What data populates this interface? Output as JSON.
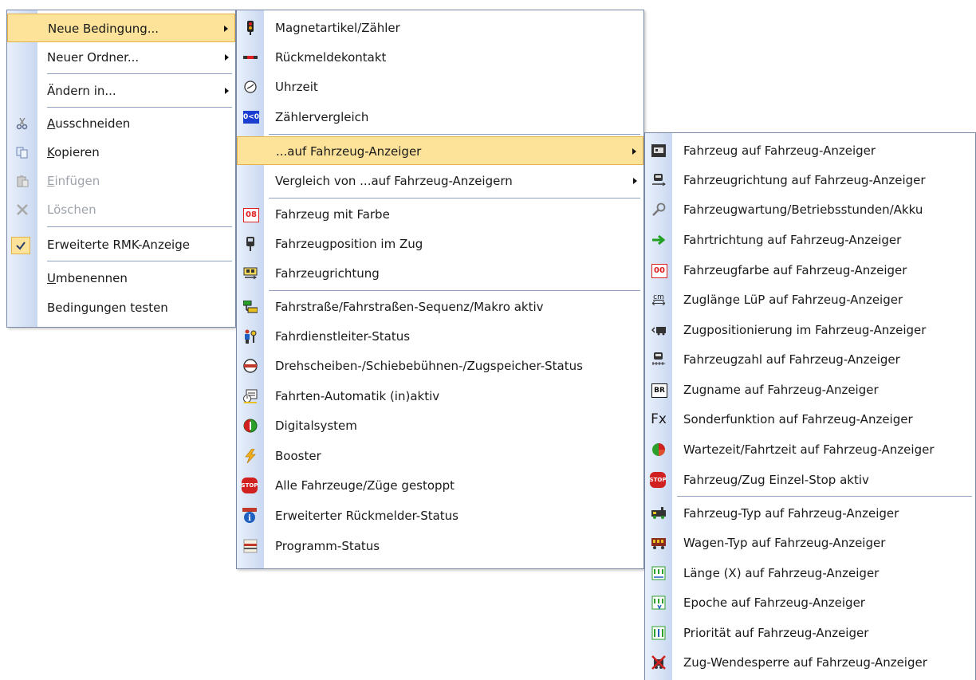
{
  "menu_main": {
    "items": [
      {
        "label": "Neue Bedingung...",
        "icon": "",
        "submenu": true,
        "highlighted": true
      },
      {
        "label": "Neuer Ordner...",
        "icon": "",
        "submenu": true
      },
      {
        "label": "Ändern in...",
        "icon": "",
        "submenu": true
      },
      {
        "label": "Ausschneiden",
        "icon": "scissors-icon",
        "accelerator_pre": "",
        "accelerator": "A",
        "accelerator_post": "usschneiden"
      },
      {
        "label": "Kopieren",
        "icon": "copy-icon",
        "accelerator_pre": "",
        "accelerator": "K",
        "accelerator_post": "opieren"
      },
      {
        "label": "Einfügen",
        "icon": "paste-icon",
        "disabled": true,
        "accelerator_pre": "",
        "accelerator": "E",
        "accelerator_post": "infügen"
      },
      {
        "label": "Löschen",
        "icon": "delete-icon",
        "disabled": true
      },
      {
        "label": "Erweiterte RMK-Anzeige",
        "icon": "checkmark-icon",
        "checked": true
      },
      {
        "label": "Umbenennen",
        "icon": "",
        "accelerator_pre": "",
        "accelerator": "U",
        "accelerator_post": "mbenennen"
      },
      {
        "label": "Bedingungen testen",
        "icon": ""
      }
    ]
  },
  "menu_conditions": {
    "items": [
      {
        "label": "Magnetartikel/Zähler",
        "icon": "signal-icon"
      },
      {
        "label": "Rückmeldekontakt",
        "icon": "feedback-contact-icon"
      },
      {
        "label": "Uhrzeit",
        "icon": "clock-icon"
      },
      {
        "label": "Zählervergleich",
        "icon": "counter-compare-icon",
        "icon_text": "0<0"
      },
      {
        "label": "...auf Fahrzeug-Anzeiger",
        "icon": "",
        "submenu": true,
        "highlighted": true
      },
      {
        "label": "Vergleich von ...auf Fahrzeug-Anzeigern",
        "icon": "",
        "submenu": true
      },
      {
        "label": "Fahrzeug mit Farbe",
        "icon": "vehicle-color-icon",
        "icon_text": "08"
      },
      {
        "label": "Fahrzeugposition im Zug",
        "icon": "vehicle-position-icon"
      },
      {
        "label": "Fahrzeugrichtung",
        "icon": "vehicle-direction-icon"
      },
      {
        "label": "Fahrstraße/Fahrstraßen-Sequenz/Makro aktiv",
        "icon": "route-icon"
      },
      {
        "label": "Fahrdienstleiter-Status",
        "icon": "dispatcher-icon"
      },
      {
        "label": "Drehscheiben-/Schiebebühnen-/Zugspeicher-Status",
        "icon": "turntable-icon"
      },
      {
        "label": "Fahrten-Automatik (in)aktiv",
        "icon": "automatic-icon"
      },
      {
        "label": "Digitalsystem",
        "icon": "digital-system-icon"
      },
      {
        "label": "Booster",
        "icon": "lightning-icon"
      },
      {
        "label": "Alle Fahrzeuge/Züge gestoppt",
        "icon": "stop-icon",
        "icon_text": "STOP"
      },
      {
        "label": "Erweiterter Rückmelder-Status",
        "icon": "info-icon",
        "icon_text": "i"
      },
      {
        "label": "Programm-Status",
        "icon": "program-icon"
      }
    ]
  },
  "menu_vehicle_display": {
    "items": [
      {
        "label": "Fahrzeug auf Fahrzeug-Anzeiger",
        "icon": "vehicle-display-icon"
      },
      {
        "label": "Fahrzeugrichtung auf Fahrzeug-Anzeiger",
        "icon": "vehicle-direction-display-icon"
      },
      {
        "label": "Fahrzeugwartung/Betriebsstunden/Akku",
        "icon": "wrench-icon"
      },
      {
        "label": "Fahrtrichtung auf Fahrzeug-Anzeiger",
        "icon": "green-arrow-icon"
      },
      {
        "label": "Fahrzeugfarbe auf Fahrzeug-Anzeiger",
        "icon": "vehicle-color-icon",
        "icon_text": "00"
      },
      {
        "label": "Zuglänge LüP auf Fahrzeug-Anzeiger",
        "icon": "length-cm-icon",
        "icon_text": "cm"
      },
      {
        "label": "Zugpositionierung im Fahrzeug-Anzeiger",
        "icon": "train-position-icon"
      },
      {
        "label": "Fahrzeugzahl auf Fahrzeug-Anzeiger",
        "icon": "vehicle-count-icon"
      },
      {
        "label": "Zugname auf Fahrzeug-Anzeiger",
        "icon": "train-name-icon",
        "icon_text": "BR"
      },
      {
        "label": "Sonderfunktion auf Fahrzeug-Anzeiger",
        "icon": "function-icon",
        "icon_text": "Fx"
      },
      {
        "label": "Wartezeit/Fahrtzeit auf Fahrzeug-Anzeiger",
        "icon": "pie-timer-icon"
      },
      {
        "label": "Fahrzeug/Zug Einzel-Stop aktiv",
        "icon": "stop-icon",
        "icon_text": "STOP"
      },
      {
        "label": "Fahrzeug-Typ auf Fahrzeug-Anzeiger",
        "icon": "vehicle-type-icon"
      },
      {
        "label": "Wagen-Typ auf Fahrzeug-Anzeiger",
        "icon": "wagon-type-icon"
      },
      {
        "label": "Länge (X) auf Fahrzeug-Anzeiger",
        "icon": "length-x-icon"
      },
      {
        "label": "Epoche auf Fahrzeug-Anzeiger",
        "icon": "epoch-icon"
      },
      {
        "label": "Priorität auf Fahrzeug-Anzeiger",
        "icon": "priority-icon"
      },
      {
        "label": "Zug-Wendesperre auf Fahrzeug-Anzeiger",
        "icon": "reverse-lock-icon"
      }
    ]
  },
  "colors": {
    "highlight": "#fde39a",
    "highlight_border": "#e3b34a",
    "separator": "#8fa0c0",
    "disabled_text": "#9ea3ab"
  }
}
